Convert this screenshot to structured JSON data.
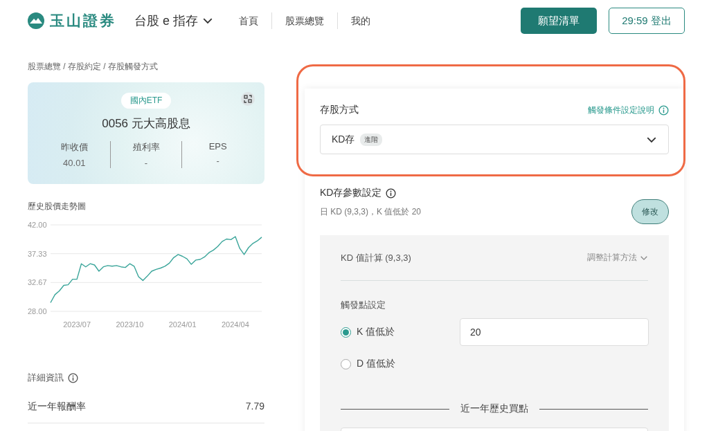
{
  "header": {
    "logo_text": "玉山證券",
    "product": "台股 e 指存",
    "nav": [
      "首頁",
      "股票總覽",
      "我的"
    ],
    "wishlist_button": "願望清單",
    "logout_button": "29:59 登出"
  },
  "breadcrumb": "股票總覽 / 存股約定 / 存股觸發方式",
  "stock_card": {
    "tag": "國內ETF",
    "title": "0056  元大高股息",
    "stats": [
      {
        "label": "昨收價",
        "value": "40.01"
      },
      {
        "label": "殖利率",
        "value": "-"
      },
      {
        "label": "EPS",
        "value": "-"
      }
    ]
  },
  "price_chart": {
    "title": "歷史股價走勢圖",
    "chart_data": {
      "type": "line",
      "categories": [
        null,
        null,
        null,
        null,
        null,
        null,
        "2023/07",
        null,
        null,
        null,
        null,
        null,
        null,
        null,
        null,
        null,
        null,
        null,
        "2023/10",
        null,
        null,
        null,
        null,
        null,
        null,
        null,
        null,
        null,
        null,
        null,
        "2024/01",
        null,
        null,
        null,
        null,
        null,
        null,
        null,
        null,
        null,
        null,
        null,
        "2024/04",
        null,
        null,
        null,
        null,
        null,
        null
      ],
      "series": [
        {
          "color": "#3aa59a",
          "values": [
            29.4,
            30.7,
            31.3,
            32.2,
            32.3,
            33.2,
            33.2,
            35.7,
            35.2,
            35.7,
            35.5,
            34.5,
            35.2,
            35.4,
            35.3,
            35.4,
            35.2,
            35.1,
            35.7,
            35.3,
            33.6,
            33.0,
            33.7,
            34.5,
            34.8,
            35.0,
            35.3,
            35.8,
            36.7,
            37.2,
            36.9,
            36.5,
            35.6,
            36.3,
            36.4,
            36.8,
            37.5,
            37.9,
            38.5,
            39.3,
            39.7,
            39.6,
            40.1,
            38.2,
            37.2,
            38.3,
            39.0,
            39.4,
            40.0
          ]
        }
      ],
      "ylim": [
        28,
        42
      ],
      "yticks": [
        {
          "value": 28,
          "label": "28.00"
        },
        {
          "value": 32.67,
          "label": "32.67"
        },
        {
          "value": 37.33,
          "label": "37.33"
        },
        {
          "value": 42,
          "label": "42.00"
        }
      ]
    }
  },
  "details": {
    "title": "詳細資訊",
    "rows": [
      {
        "label": "近一年報酬率",
        "value": "7.79"
      }
    ]
  },
  "method": {
    "label": "存股方式",
    "help_link": "觸發條件設定說明",
    "select_value": "KD存",
    "select_badge": "進階"
  },
  "params": {
    "title": "KD存參數設定",
    "summary": "日 KD (9,3,3)，K 值低於 20",
    "edit_button": "修改",
    "calc_label": "KD 值計算 (9,3,3)",
    "adjust_link": "調整計算方法",
    "trigger_title": "觸發點設定",
    "trigger_value": "20",
    "options": [
      {
        "label": "K 值低於",
        "selected": true
      },
      {
        "label": "D 值低於",
        "selected": false
      }
    ],
    "history_title": "近一年歷史買點"
  }
}
